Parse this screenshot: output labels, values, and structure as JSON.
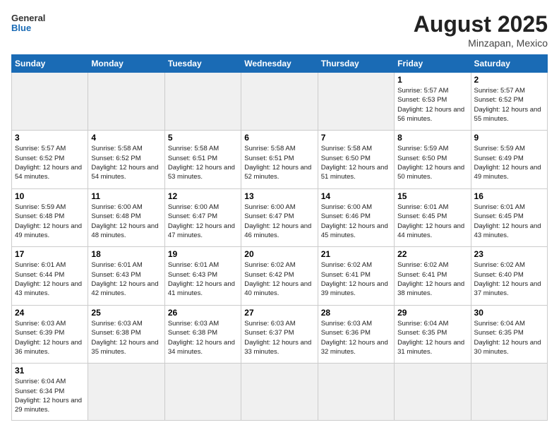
{
  "header": {
    "logo_general": "General",
    "logo_blue": "Blue",
    "month_year": "August 2025",
    "location": "Minzapan, Mexico"
  },
  "days_of_week": [
    "Sunday",
    "Monday",
    "Tuesday",
    "Wednesday",
    "Thursday",
    "Friday",
    "Saturday"
  ],
  "weeks": [
    [
      {
        "day": "",
        "info": "",
        "empty": true
      },
      {
        "day": "",
        "info": "",
        "empty": true
      },
      {
        "day": "",
        "info": "",
        "empty": true
      },
      {
        "day": "",
        "info": "",
        "empty": true
      },
      {
        "day": "",
        "info": "",
        "empty": true
      },
      {
        "day": "1",
        "info": "Sunrise: 5:57 AM\nSunset: 6:53 PM\nDaylight: 12 hours\nand 56 minutes."
      },
      {
        "day": "2",
        "info": "Sunrise: 5:57 AM\nSunset: 6:52 PM\nDaylight: 12 hours\nand 55 minutes."
      }
    ],
    [
      {
        "day": "3",
        "info": "Sunrise: 5:57 AM\nSunset: 6:52 PM\nDaylight: 12 hours\nand 54 minutes."
      },
      {
        "day": "4",
        "info": "Sunrise: 5:58 AM\nSunset: 6:52 PM\nDaylight: 12 hours\nand 54 minutes."
      },
      {
        "day": "5",
        "info": "Sunrise: 5:58 AM\nSunset: 6:51 PM\nDaylight: 12 hours\nand 53 minutes."
      },
      {
        "day": "6",
        "info": "Sunrise: 5:58 AM\nSunset: 6:51 PM\nDaylight: 12 hours\nand 52 minutes."
      },
      {
        "day": "7",
        "info": "Sunrise: 5:58 AM\nSunset: 6:50 PM\nDaylight: 12 hours\nand 51 minutes."
      },
      {
        "day": "8",
        "info": "Sunrise: 5:59 AM\nSunset: 6:50 PM\nDaylight: 12 hours\nand 50 minutes."
      },
      {
        "day": "9",
        "info": "Sunrise: 5:59 AM\nSunset: 6:49 PM\nDaylight: 12 hours\nand 49 minutes."
      }
    ],
    [
      {
        "day": "10",
        "info": "Sunrise: 5:59 AM\nSunset: 6:48 PM\nDaylight: 12 hours\nand 49 minutes."
      },
      {
        "day": "11",
        "info": "Sunrise: 6:00 AM\nSunset: 6:48 PM\nDaylight: 12 hours\nand 48 minutes."
      },
      {
        "day": "12",
        "info": "Sunrise: 6:00 AM\nSunset: 6:47 PM\nDaylight: 12 hours\nand 47 minutes."
      },
      {
        "day": "13",
        "info": "Sunrise: 6:00 AM\nSunset: 6:47 PM\nDaylight: 12 hours\nand 46 minutes."
      },
      {
        "day": "14",
        "info": "Sunrise: 6:00 AM\nSunset: 6:46 PM\nDaylight: 12 hours\nand 45 minutes."
      },
      {
        "day": "15",
        "info": "Sunrise: 6:01 AM\nSunset: 6:45 PM\nDaylight: 12 hours\nand 44 minutes."
      },
      {
        "day": "16",
        "info": "Sunrise: 6:01 AM\nSunset: 6:45 PM\nDaylight: 12 hours\nand 43 minutes."
      }
    ],
    [
      {
        "day": "17",
        "info": "Sunrise: 6:01 AM\nSunset: 6:44 PM\nDaylight: 12 hours\nand 43 minutes."
      },
      {
        "day": "18",
        "info": "Sunrise: 6:01 AM\nSunset: 6:43 PM\nDaylight: 12 hours\nand 42 minutes."
      },
      {
        "day": "19",
        "info": "Sunrise: 6:01 AM\nSunset: 6:43 PM\nDaylight: 12 hours\nand 41 minutes."
      },
      {
        "day": "20",
        "info": "Sunrise: 6:02 AM\nSunset: 6:42 PM\nDaylight: 12 hours\nand 40 minutes."
      },
      {
        "day": "21",
        "info": "Sunrise: 6:02 AM\nSunset: 6:41 PM\nDaylight: 12 hours\nand 39 minutes."
      },
      {
        "day": "22",
        "info": "Sunrise: 6:02 AM\nSunset: 6:41 PM\nDaylight: 12 hours\nand 38 minutes."
      },
      {
        "day": "23",
        "info": "Sunrise: 6:02 AM\nSunset: 6:40 PM\nDaylight: 12 hours\nand 37 minutes."
      }
    ],
    [
      {
        "day": "24",
        "info": "Sunrise: 6:03 AM\nSunset: 6:39 PM\nDaylight: 12 hours\nand 36 minutes."
      },
      {
        "day": "25",
        "info": "Sunrise: 6:03 AM\nSunset: 6:38 PM\nDaylight: 12 hours\nand 35 minutes."
      },
      {
        "day": "26",
        "info": "Sunrise: 6:03 AM\nSunset: 6:38 PM\nDaylight: 12 hours\nand 34 minutes."
      },
      {
        "day": "27",
        "info": "Sunrise: 6:03 AM\nSunset: 6:37 PM\nDaylight: 12 hours\nand 33 minutes."
      },
      {
        "day": "28",
        "info": "Sunrise: 6:03 AM\nSunset: 6:36 PM\nDaylight: 12 hours\nand 32 minutes."
      },
      {
        "day": "29",
        "info": "Sunrise: 6:04 AM\nSunset: 6:35 PM\nDaylight: 12 hours\nand 31 minutes."
      },
      {
        "day": "30",
        "info": "Sunrise: 6:04 AM\nSunset: 6:35 PM\nDaylight: 12 hours\nand 30 minutes."
      }
    ],
    [
      {
        "day": "31",
        "info": "Sunrise: 6:04 AM\nSunset: 6:34 PM\nDaylight: 12 hours\nand 29 minutes.",
        "last": true
      },
      {
        "day": "",
        "info": "",
        "empty": true,
        "last": true
      },
      {
        "day": "",
        "info": "",
        "empty": true,
        "last": true
      },
      {
        "day": "",
        "info": "",
        "empty": true,
        "last": true
      },
      {
        "day": "",
        "info": "",
        "empty": true,
        "last": true
      },
      {
        "day": "",
        "info": "",
        "empty": true,
        "last": true
      },
      {
        "day": "",
        "info": "",
        "empty": true,
        "last": true
      }
    ]
  ]
}
